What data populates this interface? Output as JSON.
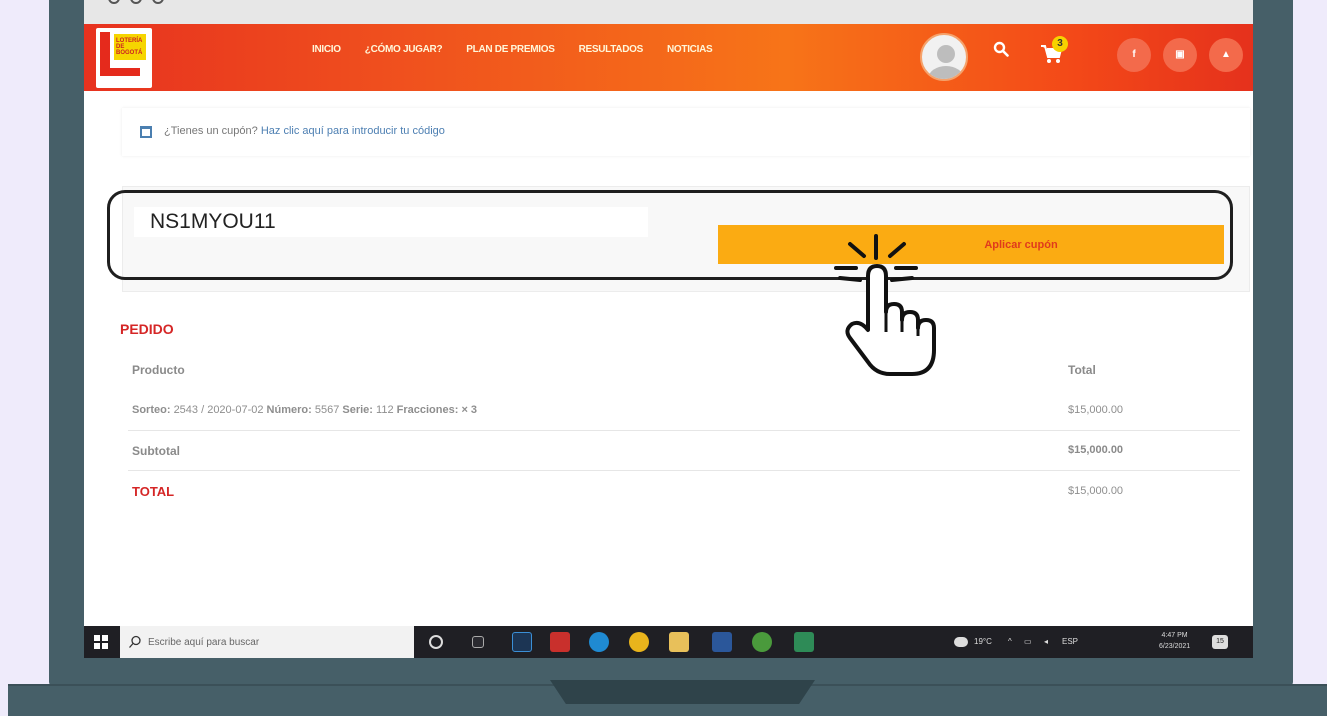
{
  "nav": {
    "links": [
      "INICIO",
      "¿CÓMO JUGAR?",
      "PLAN DE PREMIOS",
      "RESULTADOS",
      "NOTICIAS"
    ],
    "cart_count": "3",
    "social": [
      "f",
      "▣",
      "▲"
    ]
  },
  "coupon_notice": {
    "question": "¿Tienes un cupón?",
    "link": "Haz clic aquí para introducir tu código"
  },
  "coupon_form": {
    "code_value": "NS1MYOU11",
    "apply_label": "Aplicar cupón"
  },
  "order": {
    "title": "PEDIDO",
    "headers": {
      "product": "Producto",
      "total": "Total"
    },
    "item": {
      "sorteo_label": "Sorteo:",
      "sorteo_value": "2543 / 2020-07-02",
      "numero_label": "Número:",
      "numero_value": "5567",
      "serie_label": "Serie:",
      "serie_value": "112",
      "fracciones_label": "Fracciones:",
      "fracciones_value": "× 3",
      "price": "$15,000.00"
    },
    "subtotal_label": "Subtotal",
    "subtotal_value": "$15,000.00",
    "total_label": "TOTAL",
    "total_value": "$15,000.00"
  },
  "taskbar": {
    "search_placeholder": "Escribe aquí para buscar",
    "weather": "19°C",
    "lang": "ESP",
    "time": "4:47 PM",
    "date": "6/23/2021",
    "notifications": "15"
  },
  "colors": {
    "brand_red": "#d52626",
    "button_orange": "#fbab12",
    "link_blue": "#4d7fb2"
  }
}
